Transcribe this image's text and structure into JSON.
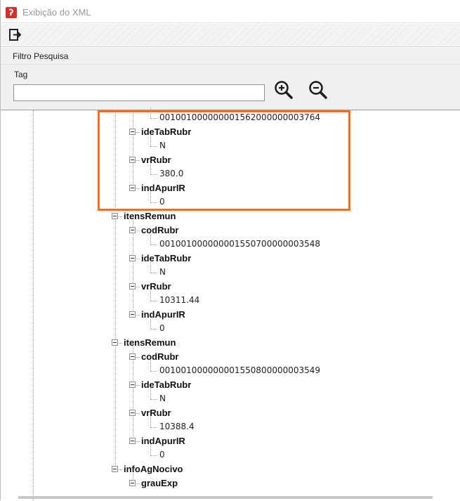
{
  "window": {
    "title": "Exibição do XML",
    "app_icon": "app-logo-icon"
  },
  "toolbar": {
    "exit_icon": "exit-icon"
  },
  "filter": {
    "header": "Filtro Pesquisa",
    "tag_label": "Tag",
    "tag_value": "",
    "zoom_in_icon": "zoom-in-icon",
    "zoom_out_icon": "zoom-out-icon"
  },
  "highlight_color": "#ff6a1a",
  "tree": [
    {
      "label": "001001000000001562000000003764",
      "kind": "value",
      "level": 3
    },
    {
      "label": "ideTabRubr",
      "kind": "element",
      "level": 2
    },
    {
      "label": "N",
      "kind": "value",
      "level": 3
    },
    {
      "label": "vrRubr",
      "kind": "element",
      "level": 2
    },
    {
      "label": "380.0",
      "kind": "value",
      "level": 3
    },
    {
      "label": "indApurIR",
      "kind": "element",
      "level": 2
    },
    {
      "label": "0",
      "kind": "value",
      "level": 3
    },
    {
      "label": "itensRemun",
      "kind": "element",
      "level": 1
    },
    {
      "label": "codRubr",
      "kind": "element",
      "level": 2
    },
    {
      "label": "001001000000001550700000003548",
      "kind": "value",
      "level": 3
    },
    {
      "label": "ideTabRubr",
      "kind": "element",
      "level": 2
    },
    {
      "label": "N",
      "kind": "value",
      "level": 3
    },
    {
      "label": "vrRubr",
      "kind": "element",
      "level": 2
    },
    {
      "label": "10311.44",
      "kind": "value",
      "level": 3
    },
    {
      "label": "indApurIR",
      "kind": "element",
      "level": 2
    },
    {
      "label": "0",
      "kind": "value",
      "level": 3
    },
    {
      "label": "itensRemun",
      "kind": "element",
      "level": 1
    },
    {
      "label": "codRubr",
      "kind": "element",
      "level": 2
    },
    {
      "label": "001001000000001550800000003549",
      "kind": "value",
      "level": 3
    },
    {
      "label": "ideTabRubr",
      "kind": "element",
      "level": 2
    },
    {
      "label": "N",
      "kind": "value",
      "level": 3
    },
    {
      "label": "vrRubr",
      "kind": "element",
      "level": 2
    },
    {
      "label": "10388.4",
      "kind": "value",
      "level": 3
    },
    {
      "label": "indApurIR",
      "kind": "element",
      "level": 2
    },
    {
      "label": "0",
      "kind": "value",
      "level": 3
    },
    {
      "label": "infoAgNocivo",
      "kind": "element",
      "level": 1
    },
    {
      "label": "grauExp",
      "kind": "element",
      "level": 2
    }
  ]
}
